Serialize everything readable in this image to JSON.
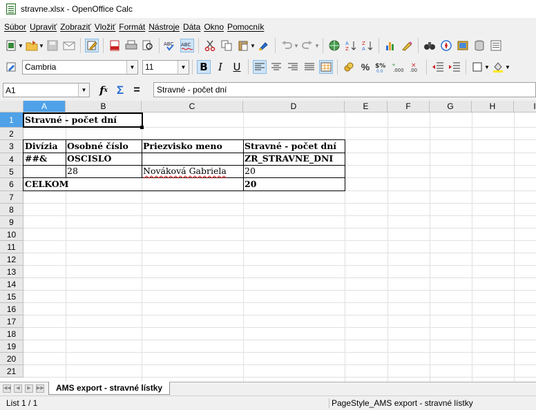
{
  "window": {
    "title": "stravne.xlsx - OpenOffice Calc"
  },
  "menu": [
    "Súbor",
    "Upraviť",
    "Zobraziť",
    "Vložiť",
    "Formát",
    "Nástroje",
    "Dáta",
    "Okno",
    "Pomocník"
  ],
  "format_toolbar": {
    "font_name": "Cambria",
    "font_size": "11"
  },
  "formula_bar": {
    "cell_ref": "A1",
    "content": "Stravné - počet dní"
  },
  "columns": [
    "A",
    "B",
    "C",
    "D",
    "E",
    "F",
    "G",
    "H",
    "I"
  ],
  "rows": [
    "1",
    "2",
    "3",
    "4",
    "5",
    "6",
    "7",
    "8",
    "9",
    "10",
    "11",
    "12",
    "13",
    "14",
    "15",
    "16",
    "17",
    "18",
    "19",
    "20",
    "21"
  ],
  "cells": {
    "A1": "Stravné - počet dní",
    "A3": "Divízia",
    "B3": "Osobné číslo",
    "C3": "Priezvisko meno",
    "D3": "Stravné - počet dní",
    "A4": "##&",
    "B4": "OSCISLO",
    "D4": "ZR_STRAVNE_DNI",
    "B5": "28",
    "C5": "Nováková Gabriela",
    "D5": "20",
    "A6": "CELKOM",
    "D6": "20"
  },
  "sheet_tab": "AMS export - stravné lístky",
  "status": {
    "sheet": "List 1 / 1",
    "page_style": "PageStyle_AMS export - stravné lístky"
  }
}
